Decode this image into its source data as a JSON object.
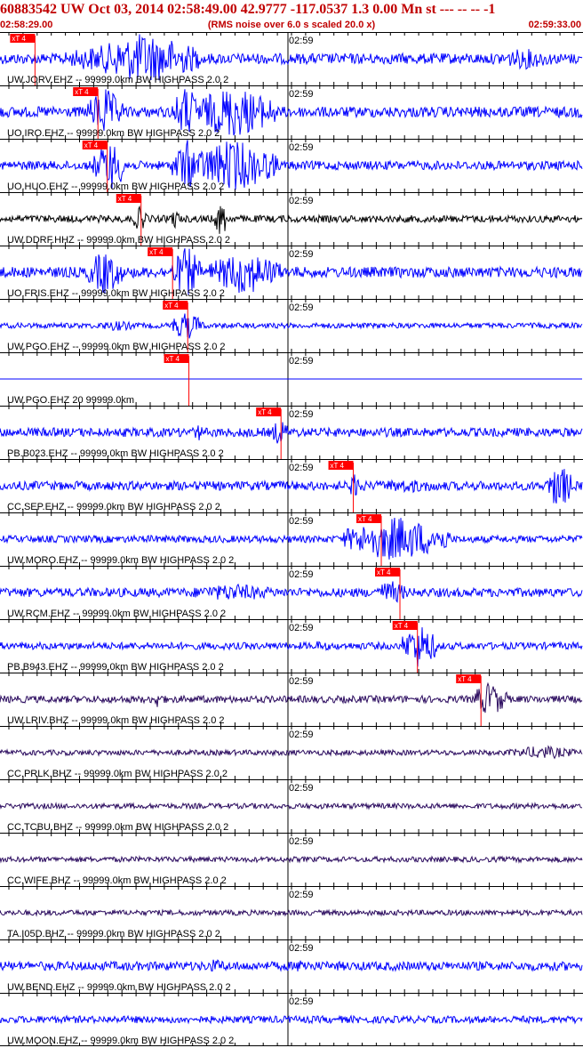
{
  "header": {
    "title": "60883542 UW Oct 03, 2014 02:58:49.00   42.9777 -117.0537  1.3 0.00 Mn st --- -- --  -1",
    "start_time": "02:58:29.00",
    "rms_note": "(RMS noise over 6.0 s scaled 20.0 x)",
    "end_time": "02:59:33.00",
    "minute_mark": "02:59",
    "pick_label": "xT 4"
  },
  "colors": {
    "header_text": "#c00000",
    "pick_red": "#ff0000",
    "blue": "#0000ff",
    "black": "#000000",
    "purple": "#2a0a5e"
  },
  "traces": [
    {
      "label": "UW.JORV.EHZ -- 99999.0km BW  HIGHPASS  2.0  2",
      "color": "blue",
      "pick": 0.06
    },
    {
      "label": "UO.IRO.EHZ -- 99999.0km BW  HIGHPASS  2.0  2",
      "color": "blue",
      "pick": 0.168
    },
    {
      "label": "UO.HUO.EHZ -- 99999.0km BW  HIGHPASS  2.0  2",
      "color": "blue",
      "pick": 0.184
    },
    {
      "label": "UW.DDRF.HHZ -- 99999.0km BW  HIGHPASS  2.0  2",
      "color": "black",
      "pick": 0.242
    },
    {
      "label": "UO.FRIS.EHZ -- 99999.0km BW  HIGHPASS  2.0  2",
      "color": "blue",
      "pick": 0.296
    },
    {
      "label": "UW.PGO.EHZ -- 99999.0km BW  HIGHPASS  2.0  2",
      "color": "blue",
      "pick": 0.322
    },
    {
      "label": "UW.PGO.EHZ 20 99999.0km",
      "color": "blue",
      "pick": 0.324
    },
    {
      "label": "PB.B023.EHZ -- 99999.0km BW  HIGHPASS  2.0  2",
      "color": "blue",
      "pick": 0.482
    },
    {
      "label": "CC.SEP.EHZ -- 99999.0km BW  HIGHPASS  2.0  2",
      "color": "blue",
      "pick": 0.606
    },
    {
      "label": "UW.MORO.EHZ -- 99999.0km BW  HIGHPASS  2.0  2",
      "color": "blue",
      "pick": 0.654
    },
    {
      "label": "UW.RCM.EHZ -- 99999.0km BW  HIGHPASS  2.0  2",
      "color": "blue",
      "pick": 0.686
    },
    {
      "label": "PB.B943.EHZ -- 99999.0km BW  HIGHPASS  2.0  2",
      "color": "blue",
      "pick": 0.716
    },
    {
      "label": "UW.LRIV.BHZ -- 99999.0km BW  HIGHPASS  2.0  2",
      "color": "purple",
      "pick": 0.825
    },
    {
      "label": "CC.PRLK.BHZ -- 99999.0km BW  HIGHPASS  2.0  2",
      "color": "purple",
      "pick": null
    },
    {
      "label": "CC.TCBU.BHZ -- 99999.0km BW  HIGHPASS  2.0  2",
      "color": "purple",
      "pick": null
    },
    {
      "label": "CC.WIFE.BHZ -- 99999.0km BW  HIGHPASS  2.0  2",
      "color": "purple",
      "pick": null
    },
    {
      "label": "TA.I05D.BHZ -- 99999.0km BW  HIGHPASS  2.0  2",
      "color": "purple",
      "pick": null
    },
    {
      "label": "UW.BEND.EHZ -- 99999.0km BW  HIGHPASS  2.0  2",
      "color": "blue",
      "pick": null
    },
    {
      "label": "UW.MOON.EHZ -- 99999.0km BW  HIGHPASS  2.0  2",
      "color": "blue",
      "pick": null
    }
  ]
}
